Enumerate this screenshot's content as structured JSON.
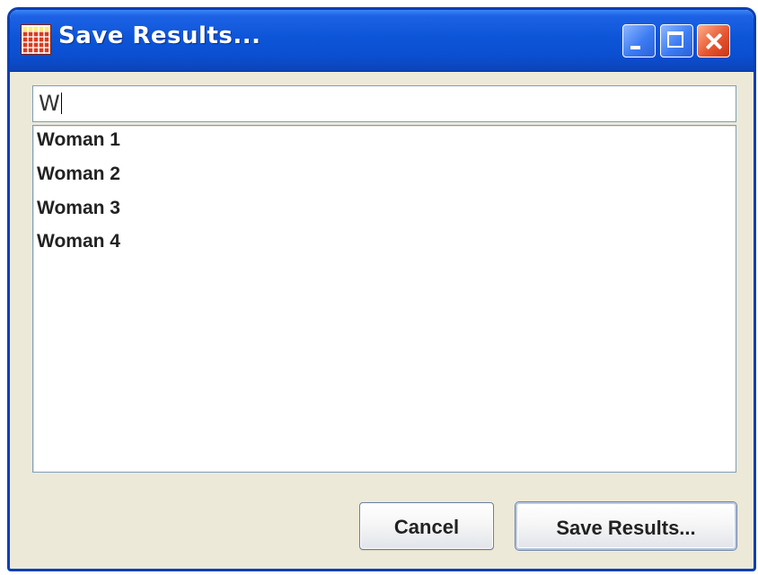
{
  "window": {
    "title": "Save Results...",
    "controls": {
      "minimize": "minimize-icon",
      "maximize": "maximize-icon",
      "close": "close-icon"
    }
  },
  "search": {
    "value": "W"
  },
  "results": [
    {
      "label": "Woman 1"
    },
    {
      "label": "Woman 2"
    },
    {
      "label": "Woman 3"
    },
    {
      "label": "Woman 4"
    }
  ],
  "buttons": {
    "cancel": "Cancel",
    "save": "Save Results..."
  },
  "colors": {
    "titlebar": "#0b4fd1",
    "dialog_background": "#ece9d8",
    "close_button": "#e5532f"
  }
}
